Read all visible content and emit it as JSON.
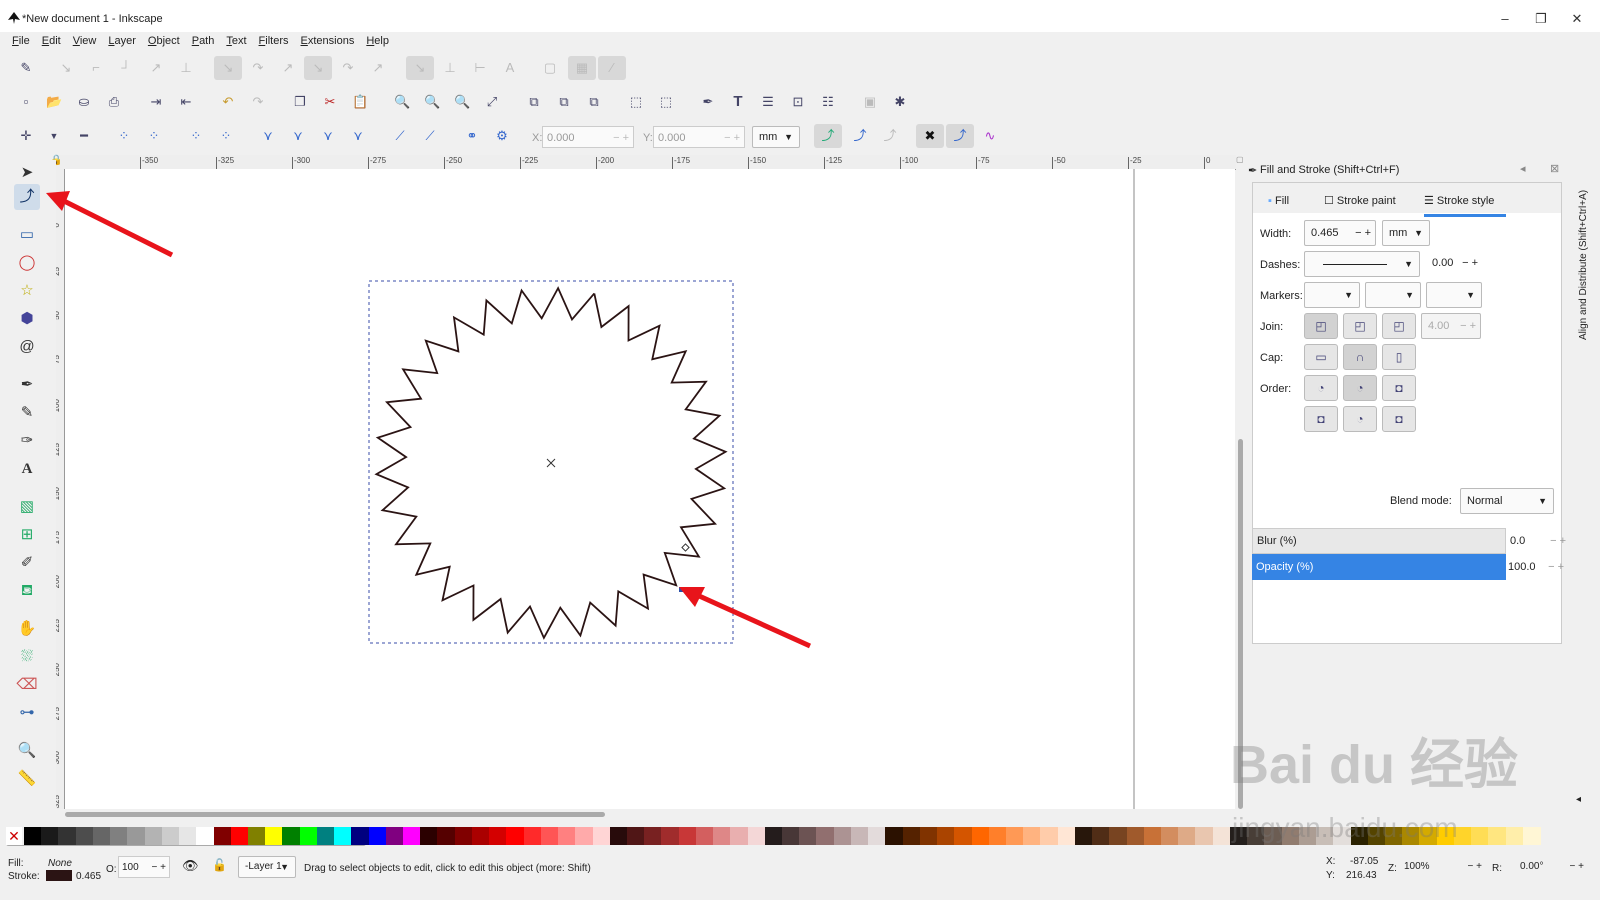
{
  "window": {
    "title": "*New document 1 - Inkscape",
    "minimize": "–",
    "restore": "❐",
    "close": "✕"
  },
  "menubar": [
    {
      "first": "F",
      "rest": "ile"
    },
    {
      "first": "E",
      "rest": "dit"
    },
    {
      "first": "V",
      "rest": "iew"
    },
    {
      "first": "L",
      "rest": "ayer"
    },
    {
      "first": "O",
      "rest": "bject"
    },
    {
      "first": "P",
      "rest": "ath"
    },
    {
      "first": "T",
      "rest": "ext"
    },
    {
      "first": "F",
      "rest": "ilters"
    },
    {
      "first": "E",
      "rest": "xtensions"
    },
    {
      "first": "H",
      "rest": "elp"
    }
  ],
  "node_toolbar": {
    "x_label": "X:",
    "x_value": "0.000",
    "y_label": "Y:",
    "y_value": "0.000",
    "unit": "mm"
  },
  "ruler": {
    "h_labels": [
      "-350",
      "-325",
      "-300",
      "-275",
      "-250",
      "-225",
      "-200",
      "-175",
      "-150",
      "-125",
      "-100",
      "-75",
      "-50",
      "-25",
      "0"
    ],
    "v_labels": [
      "0",
      "25",
      "50",
      "75",
      "100",
      "125",
      "150",
      "175",
      "200",
      "225",
      "250",
      "275",
      "300",
      "325"
    ]
  },
  "fill_stroke_panel": {
    "title": "Fill and Stroke (Shift+Ctrl+F)",
    "tabs": {
      "fill": "Fill",
      "stroke_paint": "Stroke paint",
      "stroke_style": "Stroke style"
    },
    "width_label": "Width:",
    "width_value": "0.465",
    "width_unit": "mm",
    "dashes_label": "Dashes:",
    "dashes_value": "0.00",
    "markers_label": "Markers:",
    "join_label": "Join:",
    "miter_value": "4.00",
    "cap_label": "Cap:",
    "order_label": "Order:",
    "blend_label": "Blend mode:",
    "blend_value": "Normal",
    "blur_label": "Blur (%)",
    "blur_value": "0.0",
    "opacity_label": "Opacity (%)",
    "opacity_value": "100.0"
  },
  "side_tab": "Align and Distribute (Shift+Ctrl+A)",
  "status": {
    "fill_label": "Fill:",
    "fill_value": "None",
    "stroke_label": "Stroke:",
    "stroke_width": "0.465",
    "opacity_label": "O:",
    "opacity_value": "100",
    "layer": "-Layer 1",
    "message": "Drag to select objects to edit, click to edit this object (more: Shift)",
    "cursor_x_label": "X:",
    "cursor_x": "-87.05",
    "cursor_y_label": "Y:",
    "cursor_y": "216.43",
    "zoom_label": "Z:",
    "zoom": "100%",
    "rotate_label": "R:",
    "rotate": "0.00°"
  },
  "watermark": {
    "brand": "Bai du 经验",
    "url": "jingyan.baidu.com"
  },
  "colors": {
    "selection": "#3584e4",
    "annotation_arrow": "#e8141b",
    "path_stroke": "#2b1414"
  },
  "palette": [
    "#000000",
    "#1a1a1a",
    "#333333",
    "#4d4d4d",
    "#666666",
    "#808080",
    "#999999",
    "#b3b3b3",
    "#cccccc",
    "#e6e6e6",
    "#ffffff",
    "#800000",
    "#ff0000",
    "#808000",
    "#ffff00",
    "#008000",
    "#00ff00",
    "#008080",
    "#00ffff",
    "#000080",
    "#0000ff",
    "#800080",
    "#ff00ff",
    "#2b0000",
    "#550000",
    "#800000",
    "#aa0000",
    "#d40000",
    "#ff0000",
    "#ff2a2a",
    "#ff5555",
    "#ff8080",
    "#ffaaaa",
    "#ffd5d5",
    "#280b0b",
    "#501616",
    "#782121",
    "#a02c2c",
    "#c83737",
    "#d35f5f",
    "#de8787",
    "#e9afaf",
    "#f4d7d7",
    "#241c1c",
    "#483737",
    "#6c5353",
    "#916f6f",
    "#ac9393",
    "#c8b7b7",
    "#e3dbdb",
    "#2b1100",
    "#552200",
    "#803300",
    "#aa4400",
    "#d45500",
    "#ff6600",
    "#ff7f2a",
    "#ff9955",
    "#ffb380",
    "#ffccaa",
    "#ffe6d5",
    "#28170b",
    "#502d16",
    "#784421",
    "#a05a2c",
    "#c87137",
    "#d38d5f",
    "#deaa87",
    "#e9c6af",
    "#f4e3d7",
    "#241f1c",
    "#483e37",
    "#6c5d53",
    "#917c6f",
    "#ac9d93",
    "#c8beb7",
    "#e3dedb",
    "#2b2200",
    "#554400",
    "#806600",
    "#aa8800",
    "#d4aa00",
    "#ffcc00",
    "#ffd42a",
    "#ffdd55",
    "#ffe680",
    "#ffeeaa",
    "#fff6d5"
  ]
}
